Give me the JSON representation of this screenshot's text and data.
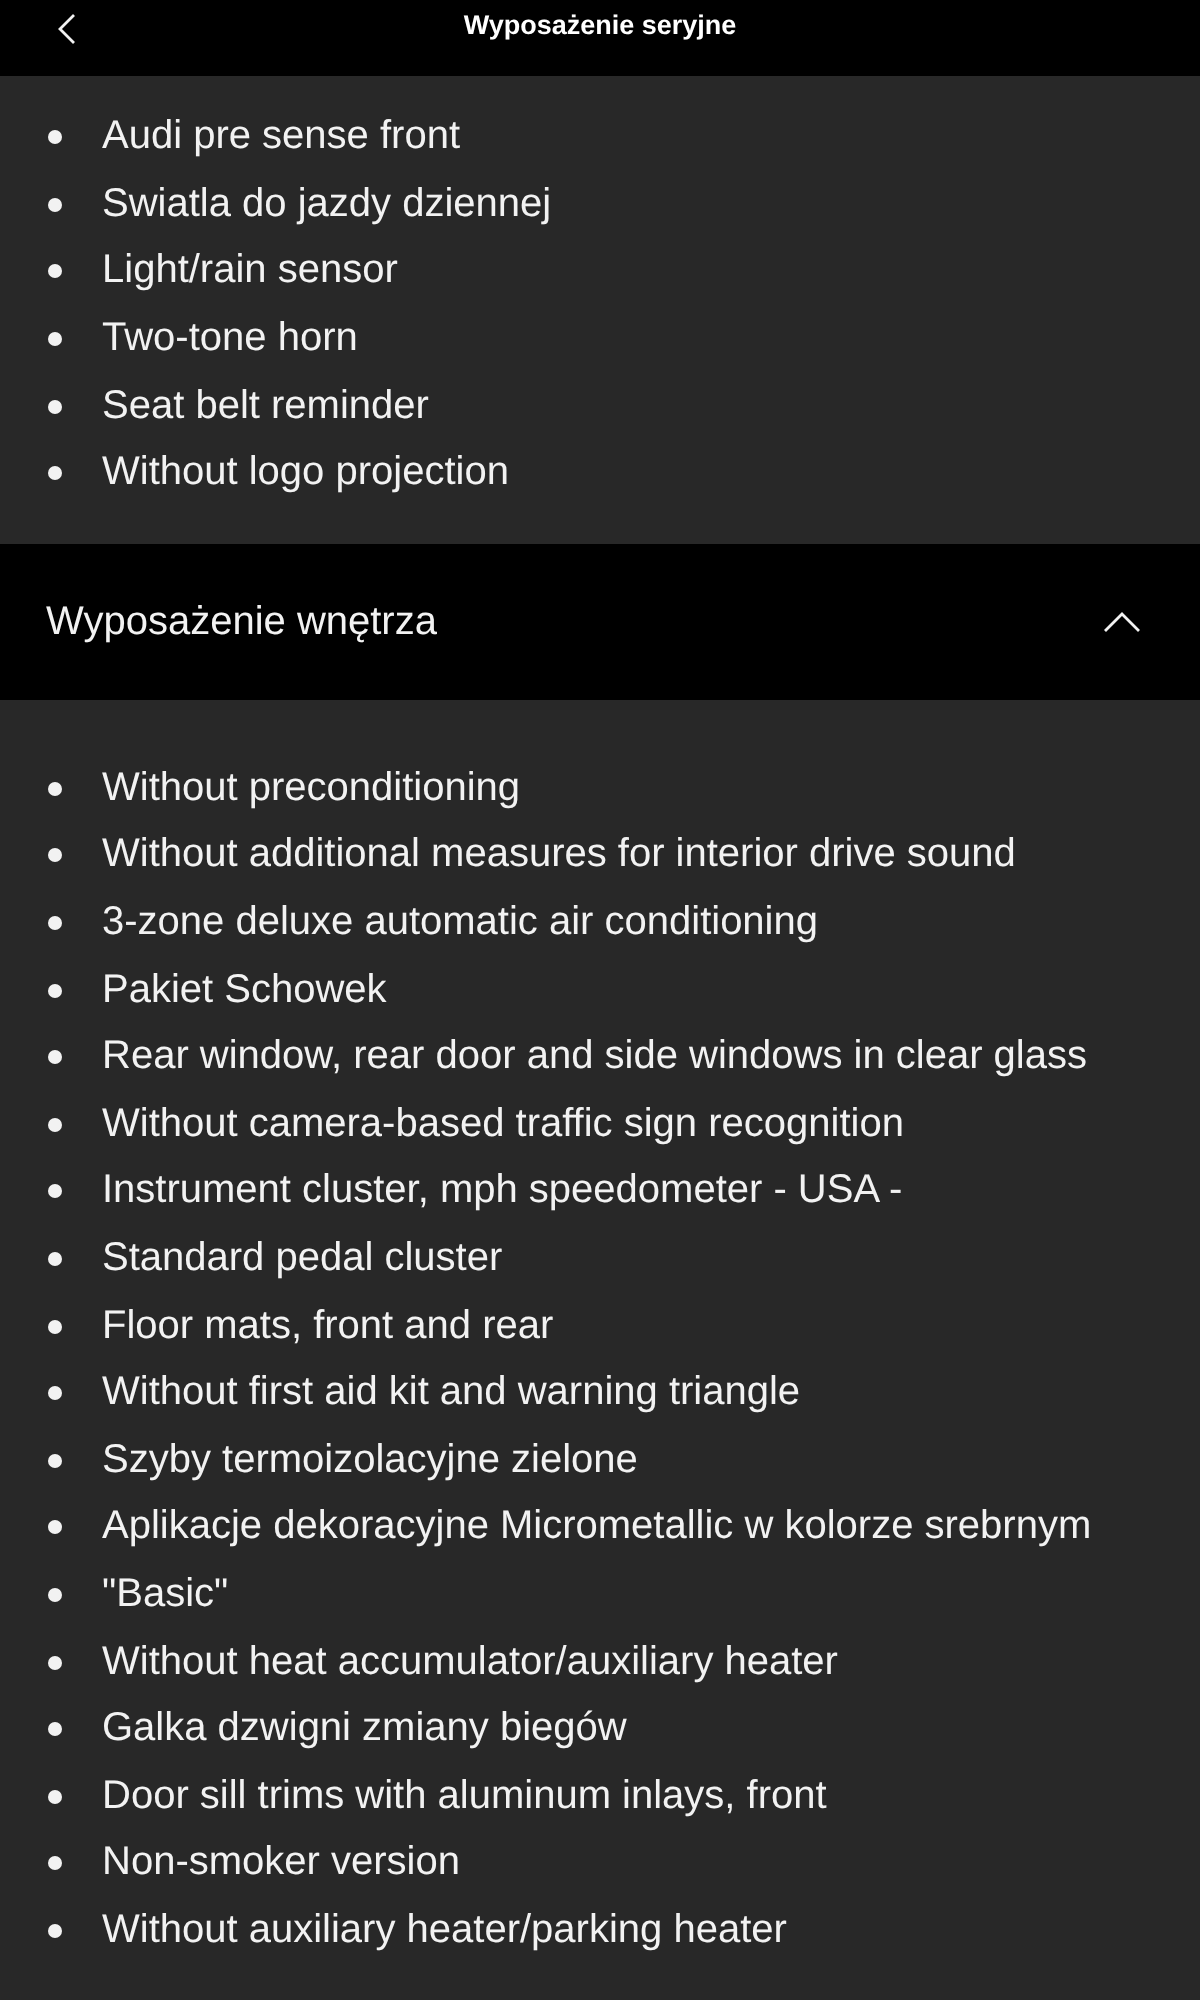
{
  "top_bar": {
    "title": "Wyposażenie seryjne"
  },
  "upper_list": {
    "items": [
      "Audi pre sense front",
      "Swiatla do jazdy dziennej",
      "Light/rain sensor",
      "Two-tone horn",
      "Seat belt reminder",
      "Without logo projection"
    ]
  },
  "section": {
    "title": "Wyposażenie wnętrza",
    "expanded": true,
    "items": [
      "Without preconditioning",
      "Without additional measures for interior drive sound",
      "3-zone deluxe automatic air conditioning",
      "Pakiet Schowek",
      "Rear window, rear door and side windows in clear glass",
      "Without camera-based traffic sign recognition",
      "Instrument cluster, mph speedometer - USA -",
      "Standard pedal cluster",
      "Floor mats, front and rear",
      "Without first aid kit and warning triangle",
      "Szyby termoizolacyjne zielone",
      "Aplikacje dekoracyjne Micrometallic w kolorze srebrnym",
      "\"Basic\"",
      "Without heat accumulator/auxiliary heater",
      "Galka dzwigni zmiany biegów",
      "Door sill trims with aluminum inlays, front",
      "Non-smoker version",
      "Without auxiliary heater/parking heater"
    ]
  }
}
